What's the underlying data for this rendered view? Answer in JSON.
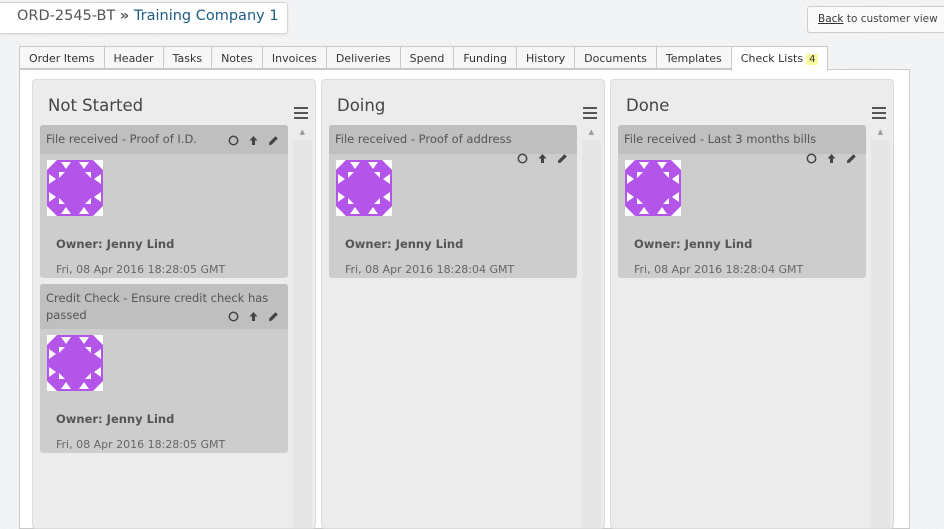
{
  "header": {
    "order_code": "ORD-2545-BT",
    "separator": "»",
    "company": "Training Company 1"
  },
  "back": {
    "link_label": "Back",
    "suffix": " to customer view"
  },
  "tabs": [
    {
      "label": "Order Items"
    },
    {
      "label": "Header"
    },
    {
      "label": "Tasks"
    },
    {
      "label": "Notes"
    },
    {
      "label": "Invoices"
    },
    {
      "label": "Deliveries"
    },
    {
      "label": "Spend"
    },
    {
      "label": "Funding"
    },
    {
      "label": "History"
    },
    {
      "label": "Documents"
    },
    {
      "label": "Templates"
    },
    {
      "label": "Check Lists",
      "badge": "4",
      "active": true
    }
  ],
  "columns": [
    {
      "title": "Not Started",
      "cards": [
        {
          "title": "File received - Proof of I.D.",
          "owner": "Owner: Jenny Lind",
          "date": "Fri, 08 Apr 2016 18:28:05 GMT"
        },
        {
          "title": "Credit Check - Ensure credit check has passed",
          "owner": "Owner: Jenny Lind",
          "date": "Fri, 08 Apr 2016 18:28:05 GMT"
        }
      ]
    },
    {
      "title": "Doing",
      "cards": [
        {
          "title": "File received - Proof of address",
          "owner": "Owner: Jenny Lind",
          "date": "Fri, 08 Apr 2016 18:28:04 GMT"
        }
      ]
    },
    {
      "title": "Done",
      "cards": [
        {
          "title": "File received - Last 3 months bills",
          "owner": "Owner: Jenny Lind",
          "date": "Fri, 08 Apr 2016 18:28:04 GMT"
        }
      ]
    }
  ],
  "colors": {
    "avatar": "#b455ea",
    "link": "#1f5d85",
    "badge": "#fbfb9c"
  }
}
